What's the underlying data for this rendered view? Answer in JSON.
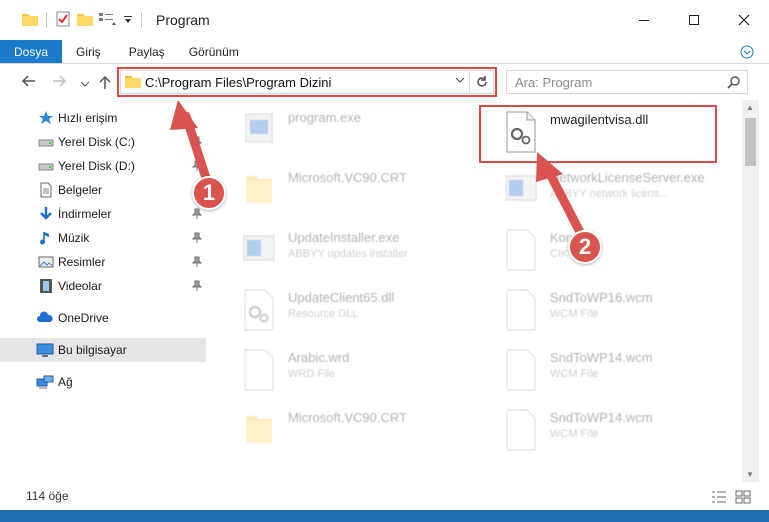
{
  "window": {
    "title": "Program",
    "minimize_icon": "minimize-icon",
    "maximize_icon": "maximize-icon",
    "close_icon": "close-icon"
  },
  "ribbon": {
    "tabs": [
      {
        "label": "Dosya"
      },
      {
        "label": "Giriş"
      },
      {
        "label": "Paylaş"
      },
      {
        "label": "Görünüm"
      }
    ]
  },
  "address_bar": {
    "path": "C:\\Program Files\\Program Dizini"
  },
  "search": {
    "placeholder": "Ara: Program"
  },
  "sidebar": {
    "items": [
      {
        "label": "Hızlı erişim",
        "icon": "star-icon"
      },
      {
        "label": "Yerel Disk (C:)",
        "icon": "drive-icon"
      },
      {
        "label": "Yerel Disk (D:)",
        "icon": "drive-icon"
      },
      {
        "label": "Belgeler",
        "icon": "documents-icon"
      },
      {
        "label": "İndirmeler",
        "icon": "download-icon"
      },
      {
        "label": "Müzik",
        "icon": "music-icon"
      },
      {
        "label": "Resimler",
        "icon": "pictures-icon"
      },
      {
        "label": "Videolar",
        "icon": "videos-icon"
      },
      {
        "label": "OneDrive",
        "icon": "cloud-icon"
      },
      {
        "label": "Bu bilgisayar",
        "icon": "computer-icon"
      },
      {
        "label": "Ağ",
        "icon": "network-icon"
      }
    ]
  },
  "files": [
    {
      "name": "program.exe",
      "sub": ""
    },
    {
      "name": "mwagilentvisa.dll",
      "sub": ""
    },
    {
      "name": "Microsoft.VC90.CRT",
      "sub": ""
    },
    {
      "name": "NetworkLicenseServer.exe",
      "sub": "ABBYY network licens..."
    },
    {
      "name": "UpdateInstaller.exe",
      "sub": "ABBYY updates installer"
    },
    {
      "name": "Korean",
      "sub": "CIK File"
    },
    {
      "name": "UpdateClient65.dll",
      "sub": "Resource DLL"
    },
    {
      "name": "SndToWP16.wcm",
      "sub": "WCM File"
    },
    {
      "name": "Arabic.wrd",
      "sub": "WRD File"
    },
    {
      "name": "SndToWP14.wcm",
      "sub": "WCM File"
    },
    {
      "name": "Microsoft.VC90.CRT",
      "sub": ""
    },
    {
      "name": "SndToWP14.wcm",
      "sub": "WCM File"
    }
  ],
  "status": {
    "count": "114 öğe"
  },
  "markers": {
    "one": "1",
    "two": "2"
  },
  "colors": {
    "accent": "#1979ca",
    "highlight": "#d94b4b",
    "marker": "#d9534f"
  }
}
